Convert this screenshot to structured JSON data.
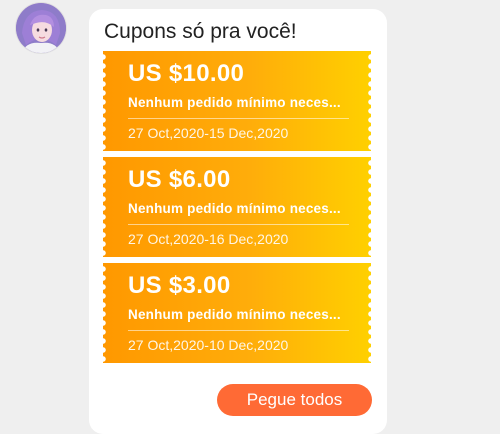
{
  "message": {
    "title": "Cupons só pra você!"
  },
  "coupons": [
    {
      "amount": "US $10.00",
      "condition": "Nenhum pedido mínimo neces...",
      "dates": "27 Oct,2020-15 Dec,2020"
    },
    {
      "amount": "US $6.00",
      "condition": "Nenhum pedido mínimo neces...",
      "dates": "27 Oct,2020-16 Dec,2020"
    },
    {
      "amount": "US $3.00",
      "condition": "Nenhum pedido mínimo neces...",
      "dates": "27 Oct,2020-10 Dec,2020"
    }
  ],
  "actions": {
    "get_all_label": "Pegue todos"
  },
  "colors": {
    "coupon_gradient_start": "#ff9800",
    "coupon_gradient_end": "#ffd000",
    "button": "#ff6a35",
    "bubble": "#ffffff",
    "background": "#efefef"
  }
}
